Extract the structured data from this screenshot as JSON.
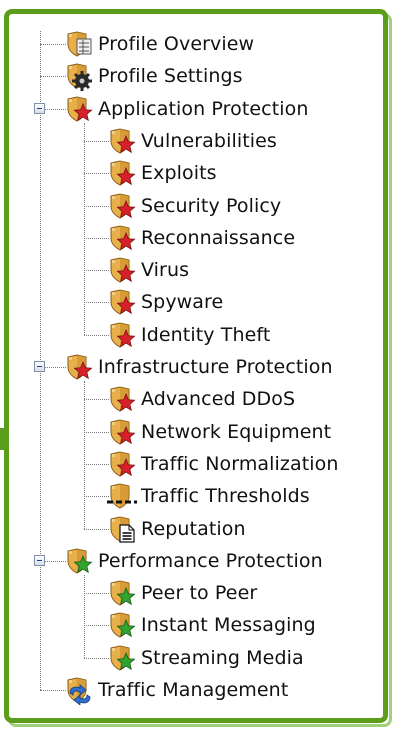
{
  "tree": {
    "items": [
      {
        "label": "Profile Overview",
        "level": 0,
        "icon": "shield-overview-icon"
      },
      {
        "label": "Profile Settings",
        "level": 0,
        "icon": "shield-gear-icon"
      },
      {
        "label": "Application Protection",
        "level": 0,
        "icon": "shield-red-star-icon",
        "expanded": true
      },
      {
        "label": "Vulnerabilities",
        "level": 1,
        "icon": "shield-red-star-icon"
      },
      {
        "label": "Exploits",
        "level": 1,
        "icon": "shield-red-star-icon"
      },
      {
        "label": "Security Policy",
        "level": 1,
        "icon": "shield-red-star-icon"
      },
      {
        "label": "Reconnaissance",
        "level": 1,
        "icon": "shield-red-star-icon"
      },
      {
        "label": "Virus",
        "level": 1,
        "icon": "shield-red-star-icon"
      },
      {
        "label": "Spyware",
        "level": 1,
        "icon": "shield-red-star-icon"
      },
      {
        "label": "Identity Theft",
        "level": 1,
        "icon": "shield-red-star-icon"
      },
      {
        "label": "Infrastructure Protection",
        "level": 0,
        "icon": "shield-red-star-icon",
        "expanded": true
      },
      {
        "label": "Advanced DDoS",
        "level": 1,
        "icon": "shield-red-star-icon"
      },
      {
        "label": "Network Equipment",
        "level": 1,
        "icon": "shield-red-star-icon"
      },
      {
        "label": "Traffic Normalization",
        "level": 1,
        "icon": "shield-red-star-icon"
      },
      {
        "label": "Traffic Thresholds",
        "level": 1,
        "icon": "shield-threshold-icon"
      },
      {
        "label": "Reputation",
        "level": 1,
        "icon": "shield-document-icon"
      },
      {
        "label": "Performance Protection",
        "level": 0,
        "icon": "shield-green-star-icon",
        "expanded": true
      },
      {
        "label": "Peer to Peer",
        "level": 1,
        "icon": "shield-green-star-icon"
      },
      {
        "label": "Instant Messaging",
        "level": 1,
        "icon": "shield-green-star-icon"
      },
      {
        "label": "Streaming Media",
        "level": 1,
        "icon": "shield-green-star-icon"
      },
      {
        "label": "Traffic Management",
        "level": 0,
        "icon": "shield-arrows-icon"
      }
    ]
  },
  "colors": {
    "frame": "#5a9e1c",
    "shield": "#e8b04a",
    "red_star": "#d8202a",
    "green_star": "#2fa52f"
  }
}
